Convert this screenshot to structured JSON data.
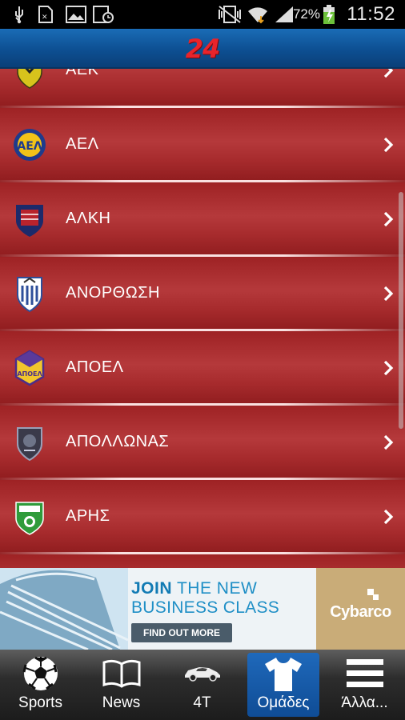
{
  "status_bar": {
    "battery_percent": "72%",
    "time": "11:52",
    "icons": [
      "usb-icon",
      "sim-card-icon",
      "gallery-icon",
      "calendar-icon",
      "vibrate-icon",
      "wifi-icon",
      "signal-icon",
      "battery-charging-icon"
    ]
  },
  "header": {
    "logo_text": "24"
  },
  "teams": [
    {
      "name": "ΑΕΚ",
      "crest_color": "#d7c31c"
    },
    {
      "name": "ΑΕΛ",
      "crest_color": "#f2c318"
    },
    {
      "name": "ΑΛΚΗ",
      "crest_color": "#1c2a6a"
    },
    {
      "name": "ΑΝΟΡΘΩΣΗ",
      "crest_color": "#2e4f9a"
    },
    {
      "name": "ΑΠΟΕΛ",
      "crest_color": "#f1c62c"
    },
    {
      "name": "ΑΠΟΛΛΩΝΑΣ",
      "crest_color": "#3a3a4a"
    },
    {
      "name": "ΑΡΗΣ",
      "crest_color": "#2f9b3a"
    }
  ],
  "ad": {
    "line1_bold": "JOIN",
    "line1_rest": " THE NEW",
    "line2": "BUSINESS CLASS",
    "cta": "FIND OUT MORE",
    "brand": "Cybarco"
  },
  "bottom_nav": {
    "tabs": [
      {
        "label": "Sports",
        "icon": "soccer-ball-icon"
      },
      {
        "label": "News",
        "icon": "open-book-icon"
      },
      {
        "label": "4T",
        "icon": "car-icon"
      },
      {
        "label": "Ομάδες",
        "icon": "jersey-icon",
        "active": true
      },
      {
        "label": "Άλλα...",
        "icon": "menu-icon"
      }
    ]
  },
  "colors": {
    "header_blue": "#0d4f92",
    "list_red": "#a82a2c",
    "logo_red": "#e8242b",
    "active_tab": "#1f69bb"
  }
}
